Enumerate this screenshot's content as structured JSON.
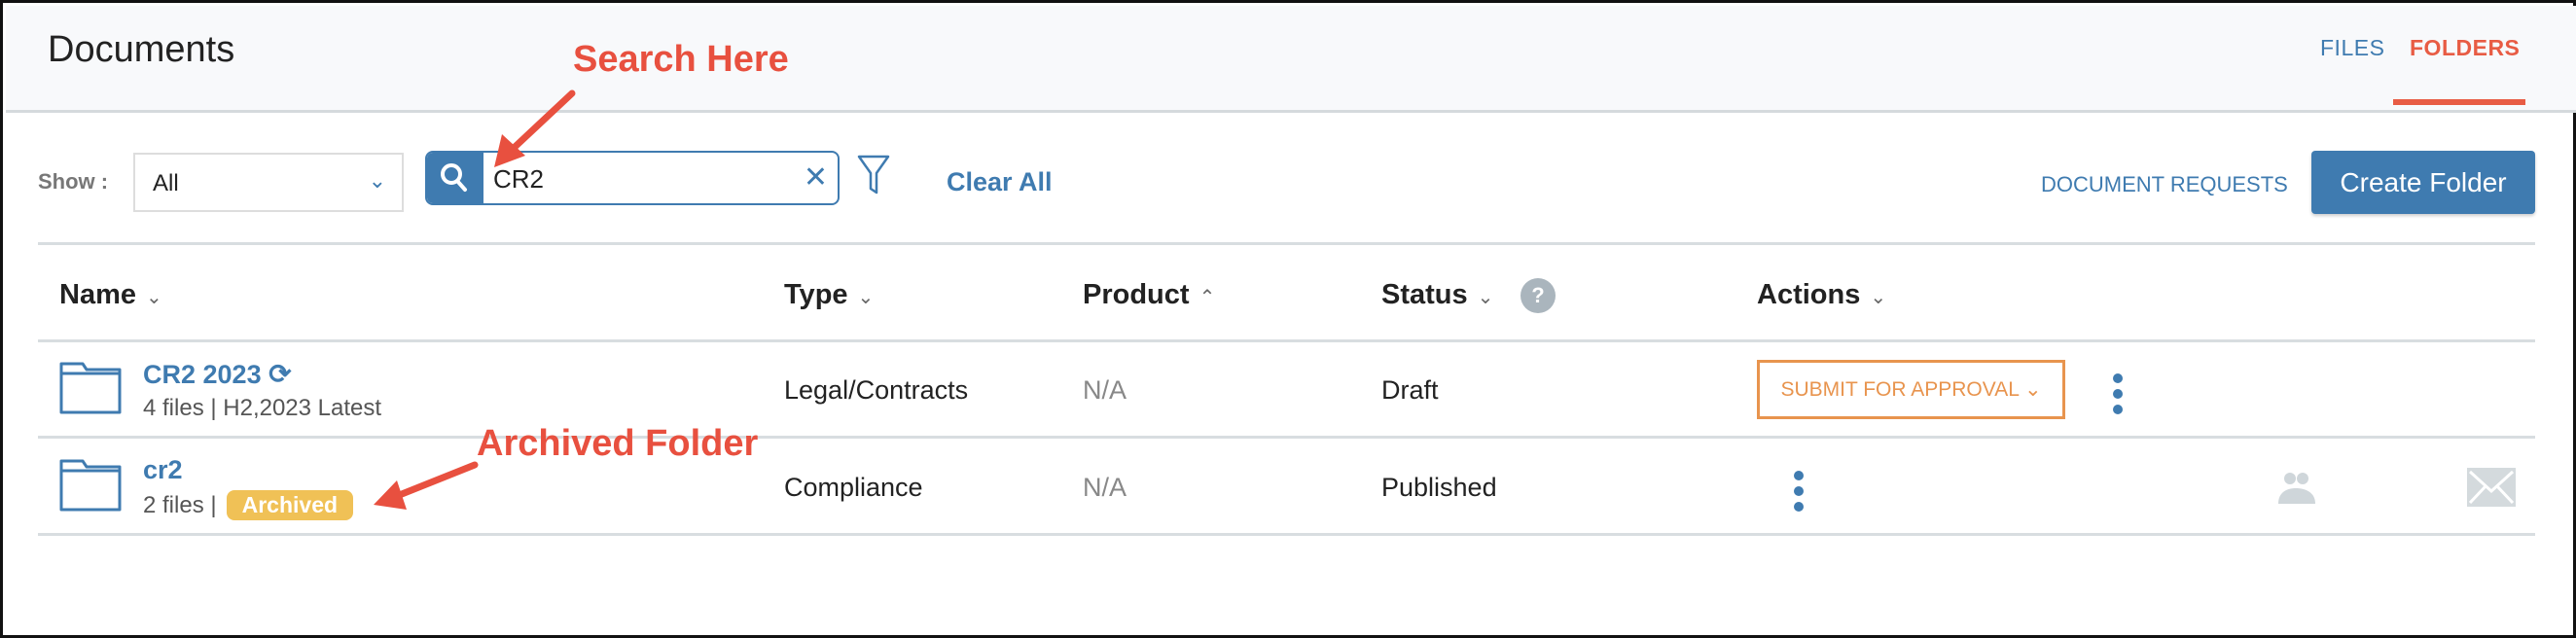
{
  "header": {
    "title": "Documents",
    "tabs": [
      {
        "label": "FILES",
        "active": false
      },
      {
        "label": "FOLDERS",
        "active": true
      }
    ]
  },
  "toolbar": {
    "show_label": "Show :",
    "show_value": "All",
    "search_value": "CR2",
    "clear_all": "Clear All",
    "document_requests": "DOCUMENT REQUESTS",
    "create_folder": "Create Folder"
  },
  "table": {
    "columns": [
      {
        "label": "Name",
        "sort": "down"
      },
      {
        "label": "Type",
        "sort": "down"
      },
      {
        "label": "Product",
        "sort": "up"
      },
      {
        "label": "Status",
        "sort": "down"
      },
      {
        "label": "Actions",
        "sort": "down"
      }
    ],
    "rows": [
      {
        "name": "CR2 2023",
        "meta": "4 files | H2,2023 Latest",
        "type": "Legal/Contracts",
        "product": "N/A",
        "status": "Draft",
        "action": "SUBMIT FOR APPROVAL",
        "synced": true
      },
      {
        "name": "cr2",
        "meta": "2 files |",
        "badge": "Archived",
        "type": "Compliance",
        "product": "N/A",
        "status": "Published"
      }
    ]
  },
  "annotations": {
    "search": "Search Here",
    "archived": "Archived Folder"
  },
  "colors": {
    "primary": "#3f7bb0",
    "accent": "#e85c44",
    "warning": "#e8944e",
    "badge": "#f0c156",
    "annotation": "#e8503f"
  }
}
